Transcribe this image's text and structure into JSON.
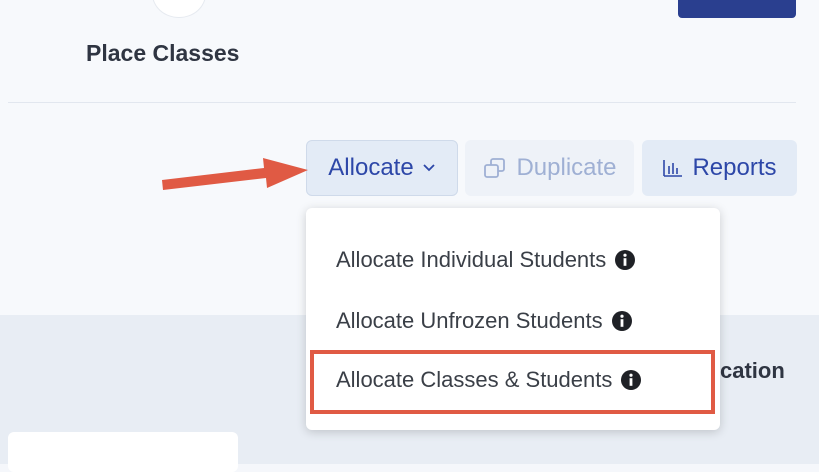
{
  "page": {
    "title": "Place Classes"
  },
  "toolbar": {
    "allocate_label": "Allocate",
    "duplicate_label": "Duplicate",
    "reports_label": "Reports"
  },
  "dropdown": {
    "items": [
      {
        "label": "Allocate Individual Students"
      },
      {
        "label": "Allocate Unfrozen Students"
      },
      {
        "label": "Allocate Classes & Students"
      }
    ]
  },
  "background": {
    "partial_heading": "cation"
  },
  "colors": {
    "accent": "#2d47a8",
    "highlight": "#e05a44",
    "arrow": "#e05a44"
  },
  "icons": {
    "allocate": "chevron-down-icon",
    "duplicate": "copy-icon",
    "reports": "bar-chart-icon",
    "info": "info-icon"
  }
}
